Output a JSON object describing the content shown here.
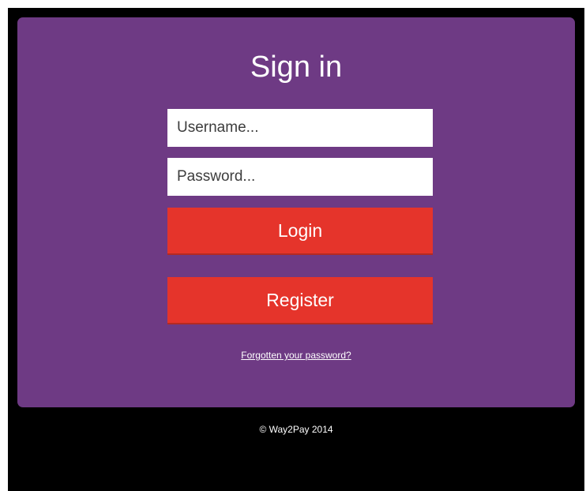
{
  "signin": {
    "title": "Sign in",
    "username_placeholder": "Username...",
    "password_placeholder": "Password...",
    "login_label": "Login",
    "register_label": "Register",
    "forgot_label": "Forgotten your password?"
  },
  "footer": {
    "copyright": "© Way2Pay 2014"
  },
  "colors": {
    "page_background": "#000000",
    "card_background": "#6e3a84",
    "button_background": "#e5342b",
    "text": "#ffffff"
  }
}
